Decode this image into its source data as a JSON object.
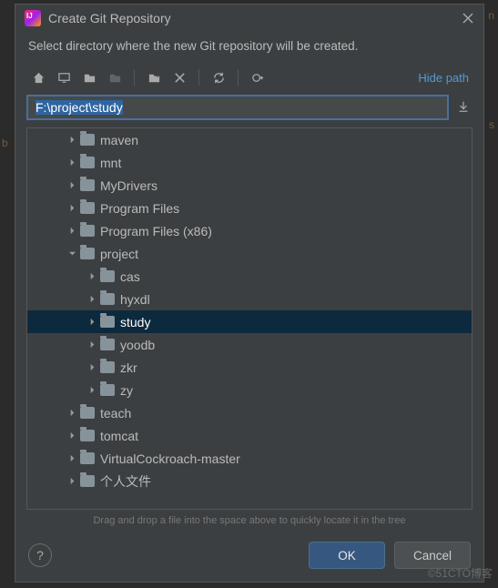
{
  "bg": {
    "left_char": "b",
    "right_top_char": "n",
    "right_char": "s"
  },
  "dialog": {
    "title": "Create Git Repository",
    "instruction": "Select directory where the new Git repository will be created.",
    "hide_path": "Hide path",
    "path_value": "F:\\project\\study",
    "tree_hint": "Drag and drop a file into the space above to quickly locate it in the tree",
    "toolbar": {
      "home": "home",
      "desktop": "desktop",
      "project_dir": "project-dir",
      "module_dir": "module-dir",
      "new_folder": "new-folder",
      "delete": "delete",
      "refresh": "refresh",
      "show_hidden": "show-hidden"
    }
  },
  "tree": [
    {
      "label": "maven",
      "depth": 1,
      "expanded": false,
      "selected": false
    },
    {
      "label": "mnt",
      "depth": 1,
      "expanded": false,
      "selected": false
    },
    {
      "label": "MyDrivers",
      "depth": 1,
      "expanded": false,
      "selected": false
    },
    {
      "label": "Program Files",
      "depth": 1,
      "expanded": false,
      "selected": false
    },
    {
      "label": "Program Files (x86)",
      "depth": 1,
      "expanded": false,
      "selected": false
    },
    {
      "label": "project",
      "depth": 1,
      "expanded": true,
      "selected": false
    },
    {
      "label": "cas",
      "depth": 2,
      "expanded": false,
      "selected": false
    },
    {
      "label": "hyxdl",
      "depth": 2,
      "expanded": false,
      "selected": false
    },
    {
      "label": "study",
      "depth": 2,
      "expanded": false,
      "selected": true
    },
    {
      "label": "yoodb",
      "depth": 2,
      "expanded": false,
      "selected": false
    },
    {
      "label": "zkr",
      "depth": 2,
      "expanded": false,
      "selected": false
    },
    {
      "label": "zy",
      "depth": 2,
      "expanded": false,
      "selected": false
    },
    {
      "label": "teach",
      "depth": 1,
      "expanded": false,
      "selected": false
    },
    {
      "label": "tomcat",
      "depth": 1,
      "expanded": false,
      "selected": false
    },
    {
      "label": "VirtualCockroach-master",
      "depth": 1,
      "expanded": false,
      "selected": false
    },
    {
      "label": "个人文件",
      "depth": 1,
      "expanded": false,
      "selected": false
    }
  ],
  "buttons": {
    "ok": "OK",
    "cancel": "Cancel",
    "help": "?"
  },
  "watermark": "©51CTO博客"
}
